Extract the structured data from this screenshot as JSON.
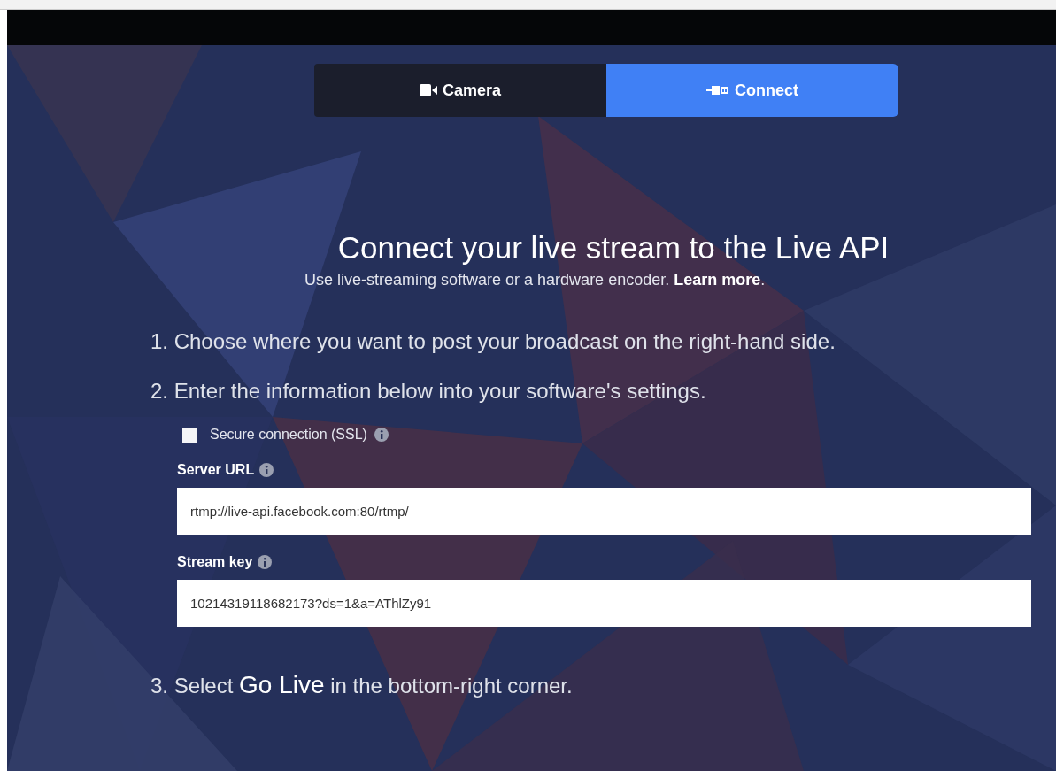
{
  "tabs": [
    {
      "label": "Camera",
      "selected": false
    },
    {
      "label": "Connect",
      "selected": true
    }
  ],
  "heading": "Connect your live stream to the Live API",
  "subtitle": {
    "text": "Use live-streaming software or a hardware encoder. ",
    "link": "Learn more",
    "end": "."
  },
  "steps": [
    {
      "text": "1. Choose where you want to post your broadcast on the right-hand side."
    },
    {
      "text": "2. Enter the information below into your software's settings."
    }
  ],
  "ssl": {
    "label": "Secure connection (SSL)",
    "checked": false
  },
  "fields": [
    {
      "label": "Server URL",
      "value": "rtmp://live-api.facebook.com:80/rtmp/"
    },
    {
      "label": "Stream key",
      "value": "10214319118682173?ds=1&a=AThlZy91"
    }
  ],
  "final_step": "3. Select **Go Live** in the bottom-right corner."
}
